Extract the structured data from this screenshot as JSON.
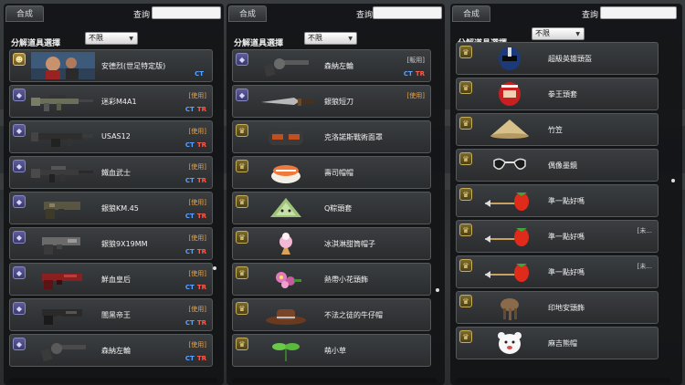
{
  "panels": [
    {
      "tab": "合成",
      "search_label": "查詢",
      "search_value": "",
      "filter_label": "分解道具選擇",
      "filter_value": "不限",
      "items": [
        {
          "name": "安德烈(世足特定版)",
          "status": "",
          "ct": "CT",
          "tr": "",
          "badge": "face",
          "icon": "portrait-icon"
        },
        {
          "name": "迷彩M4A1",
          "status": "[使用]",
          "ct": "CT",
          "tr": "TR",
          "badge": "weapon",
          "icon": "rifle-icon"
        },
        {
          "name": "USAS12",
          "status": "[使用]",
          "ct": "CT",
          "tr": "TR",
          "badge": "weapon",
          "icon": "shotgun-icon"
        },
        {
          "name": "鐵血武士",
          "status": "[使用]",
          "ct": "CT",
          "tr": "TR",
          "badge": "weapon",
          "icon": "rifle-icon"
        },
        {
          "name": "銀狼KM.45",
          "status": "[使用]",
          "ct": "CT",
          "tr": "TR",
          "badge": "weapon",
          "icon": "pistol-icon"
        },
        {
          "name": "銀狼9X19MM",
          "status": "[使用]",
          "ct": "CT",
          "tr": "TR",
          "badge": "weapon",
          "icon": "pistol-icon"
        },
        {
          "name": "鮮血皇后",
          "status": "[使用]",
          "ct": "CT",
          "tr": "TR",
          "badge": "weapon",
          "icon": "pistol-icon"
        },
        {
          "name": "闇黑帝王",
          "status": "[使用]",
          "ct": "CT",
          "tr": "TR",
          "badge": "weapon",
          "icon": "pistol-icon"
        },
        {
          "name": "森納左輪",
          "status": "[使用]",
          "ct": "CT",
          "tr": "TR",
          "badge": "weapon",
          "icon": "revolver-icon"
        }
      ]
    },
    {
      "tab": "合成",
      "search_label": "查詢",
      "search_value": "",
      "filter_label": "分解道具選擇",
      "filter_value": "不限",
      "items": [
        {
          "name": "森納左輪",
          "status": "[販用]",
          "ct": "CT",
          "tr": "TR",
          "badge": "weapon",
          "icon": "revolver-icon"
        },
        {
          "name": "銀狼短刀",
          "status": "[使用]",
          "ct": "",
          "tr": "",
          "badge": "weapon",
          "icon": "knife-icon"
        },
        {
          "name": "克洛諾斯戰術面罩",
          "status": "",
          "ct": "",
          "tr": "",
          "badge": "hat",
          "icon": "mask-icon"
        },
        {
          "name": "壽司帽帽",
          "status": "",
          "ct": "",
          "tr": "",
          "badge": "hat",
          "icon": "sushi-hat-icon"
        },
        {
          "name": "Q粽頭套",
          "status": "",
          "ct": "",
          "tr": "",
          "badge": "hat",
          "icon": "zongzi-hat-icon"
        },
        {
          "name": "冰淇淋甜筒帽子",
          "status": "",
          "ct": "",
          "tr": "",
          "badge": "hat",
          "icon": "icecream-hat-icon"
        },
        {
          "name": "熱帶小花頭飾",
          "status": "",
          "ct": "",
          "tr": "",
          "badge": "hat",
          "icon": "flower-icon"
        },
        {
          "name": "不法之徒的牛仔帽",
          "status": "",
          "ct": "",
          "tr": "",
          "badge": "hat",
          "icon": "cowboy-hat-icon"
        },
        {
          "name": "萌小草",
          "status": "",
          "ct": "",
          "tr": "",
          "badge": "hat",
          "icon": "sprout-icon"
        }
      ]
    },
    {
      "tab": "合成",
      "search_label": "查詢",
      "search_value": "",
      "filter_label": "分解道具選擇",
      "filter_value": "不限",
      "items": [
        {
          "name": "超級英雄頭盔",
          "note": "",
          "badge": "hat",
          "icon": "helmet-icon"
        },
        {
          "name": "拳王頭套",
          "note": "",
          "badge": "hat",
          "icon": "boxing-headgear-icon"
        },
        {
          "name": "竹笠",
          "note": "",
          "badge": "hat",
          "icon": "bamboo-hat-icon"
        },
        {
          "name": "偶像墨鏡",
          "note": "",
          "badge": "hat",
          "icon": "sunglasses-icon"
        },
        {
          "name": "準一點好嗎",
          "note": "",
          "badge": "hat",
          "icon": "strawberry-arrow-icon"
        },
        {
          "name": "準一點好嗎",
          "note": "[未...",
          "badge": "hat",
          "icon": "strawberry-arrow-icon"
        },
        {
          "name": "準一點好嗎",
          "note": "[未...",
          "badge": "hat",
          "icon": "strawberry-arrow-icon"
        },
        {
          "name": "印地安頭飾",
          "note": "",
          "badge": "hat",
          "icon": "feather-headdress-icon"
        },
        {
          "name": "麻吉熊帽",
          "note": "",
          "badge": "hat",
          "icon": "bear-hat-icon"
        }
      ]
    }
  ],
  "colors": {
    "status": "#e6a34a",
    "ct": "#5aa2ff",
    "tr": "#ff5a4a"
  }
}
